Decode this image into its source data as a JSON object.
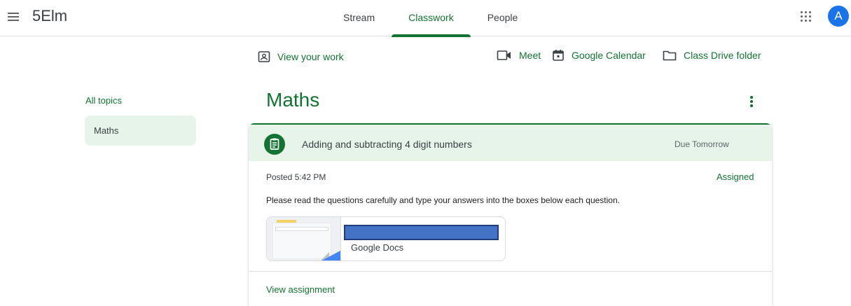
{
  "header": {
    "class_name": "5Elm",
    "tabs": [
      {
        "label": "Stream",
        "active": false
      },
      {
        "label": "Classwork",
        "active": true
      },
      {
        "label": "People",
        "active": false
      }
    ],
    "avatar_letter": "A",
    "icons": {
      "menu": "hamburger-menu-icon",
      "apps": "google-apps-icon"
    }
  },
  "toolbar": {
    "view_work": "View your work",
    "meet": "Meet",
    "calendar": "Google Calendar",
    "drive": "Class Drive folder"
  },
  "sidebar": {
    "all_topics": "All topics",
    "topics": [
      "Maths"
    ]
  },
  "topic": {
    "title": "Maths",
    "assignment": {
      "title": "Adding and subtracting 4 digit numbers",
      "due": "Due Tomorrow",
      "posted": "Posted 5:42 PM",
      "status": "Assigned",
      "description": "Please read the questions carefully and type your answers into the boxes below each question.",
      "attachment": {
        "type": "Google Docs"
      },
      "view_link": "View assignment"
    }
  },
  "colors": {
    "brand_green": "#137333",
    "highlight_green": "#e6f4ea",
    "avatar_blue": "#1a73e8",
    "redaction_blue": "#4472c4"
  }
}
